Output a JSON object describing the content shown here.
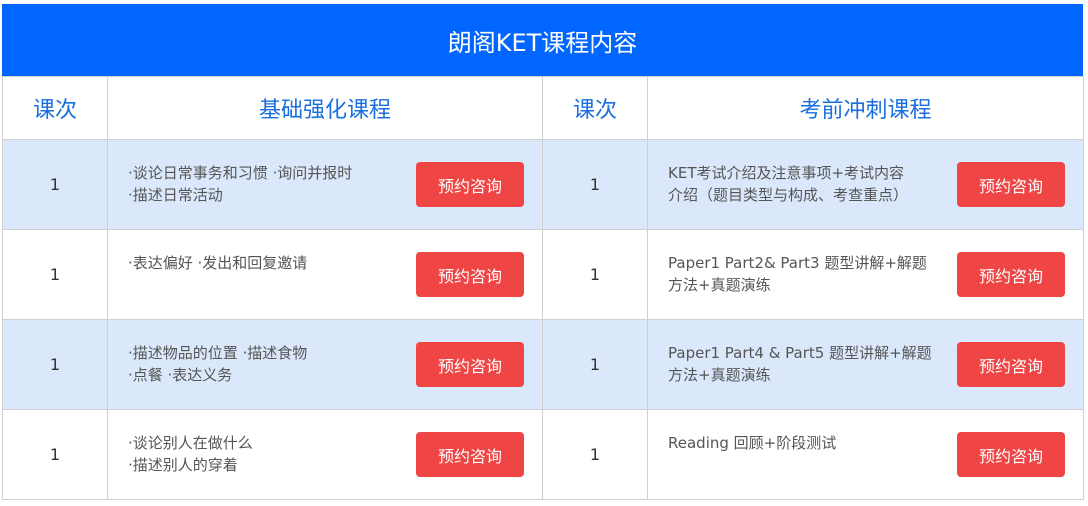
{
  "title": "朗阁KET课程内容",
  "headers": {
    "num1": "课次",
    "basic": "基础强化课程",
    "num2": "课次",
    "sprint": "考前冲刺课程"
  },
  "button_label": "预约咨询",
  "colors": {
    "title_bg": "#0066ff",
    "header_text": "#1a6fe0",
    "row_shade": "#dbe8fb",
    "button_bg": "#ef4545"
  },
  "rows": [
    {
      "num1": "1",
      "basic": "·谈论日常事务和习惯 ·询问并报时\n·描述日常活动",
      "num2": "1",
      "sprint": "KET考试介绍及注意事项+考试内容\n介绍（题目类型与构成、考查重点）"
    },
    {
      "num1": "1",
      "basic": "·表达偏好 ·发出和回复邀请",
      "num2": "1",
      "sprint": "Paper1 Part2& Part3 题型讲解+解题\n方法+真题演练"
    },
    {
      "num1": "1",
      "basic": "·描述物品的位置 ·描述食物\n·点餐 ·表达义务",
      "num2": "1",
      "sprint": "Paper1 Part4 & Part5 题型讲解+解题\n方法+真题演练"
    },
    {
      "num1": "1",
      "basic": "·谈论别人在做什么\n·描述别人的穿着",
      "num2": "1",
      "sprint": "Reading 回顾+阶段测试"
    }
  ]
}
